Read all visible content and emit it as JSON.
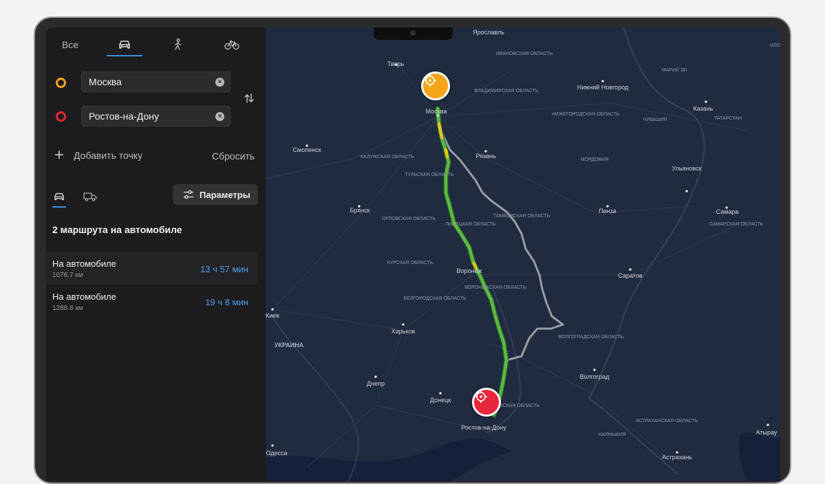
{
  "modes": {
    "all": "Все",
    "car_icon": "car-icon",
    "walk_icon": "walk-icon",
    "bike_icon": "bike-icon"
  },
  "from": {
    "value": "Москва",
    "pin_color": "#f5a417"
  },
  "to": {
    "value": "Ростов-на-Дону",
    "pin_color": "#e8273b"
  },
  "add_point": "Добавить точку",
  "reset": "Сбросить",
  "params_label": "Параметры",
  "routes_title": "2 маршрута на автомобиле",
  "routes": [
    {
      "name": "На автомобиле",
      "distance": "1076.7 км",
      "time": "13 ч 57 мин",
      "selected": true
    },
    {
      "name": "На автомобиле",
      "distance": "1288.8 км",
      "time": "19 ч 8 мин",
      "selected": false
    }
  ],
  "colors": {
    "accent": "#3b8fe0",
    "route_main": "#5cb944",
    "route_alt": "#9a9ca1",
    "start_marker": "#f5a417",
    "end_marker": "#e8273b"
  },
  "map_labels": {
    "cities": [
      "Ярославль",
      "Тверь",
      "Москва",
      "Нижний Новгород",
      "Казань",
      "Смоленск",
      "Рязань",
      "Ульяновск",
      "Брянск",
      "Пенза",
      "Самара",
      "Саратов",
      "Воронеж",
      "Киев",
      "Харьков",
      "Волгоград",
      "Днепр",
      "Донецк",
      "Ростов-на-Дону",
      "Астрахань",
      "Одесса",
      "Атырау"
    ],
    "regions": [
      "ИВАНОВСКАЯ ОБЛАСТЬ",
      "МАРИЙ ЭЛ",
      "ВЛАДИМИРСКАЯ ОБЛАСТЬ",
      "НИЖЕГОРОДСКАЯ ОБЛАСТЬ",
      "ЧУВАШИЯ",
      "ТАТАРСТАН",
      "КАЛУЖСКАЯ ОБЛАСТЬ",
      "МОРДОВИЯ",
      "ТУЛЬСКАЯ ОБЛАСТЬ",
      "ОРЛОВСКАЯ ОБЛАСТЬ",
      "ЛИПЕЦКАЯ ОБЛАСТЬ",
      "ТАМБОВСКАЯ ОБЛАСТЬ",
      "САМАРСКАЯ ОБЛАСТЬ",
      "КУРСКАЯ ОБЛАСТЬ",
      "ВОРОНЕЖСКАЯ ОБЛАСТЬ",
      "БЕЛГОРОДСКАЯ ОБЛАСТЬ",
      "ВОЛГОГРАДСКАЯ ОБЛАСТЬ",
      "РОСТОВСКАЯ ОБЛАСТЬ",
      "АСТРАХАНСКАЯ ОБЛАСТЬ",
      "КАЛМЫКИЯ"
    ],
    "countries": [
      "УКРАИНА"
    ],
    "edge_partial": "UDG"
  }
}
